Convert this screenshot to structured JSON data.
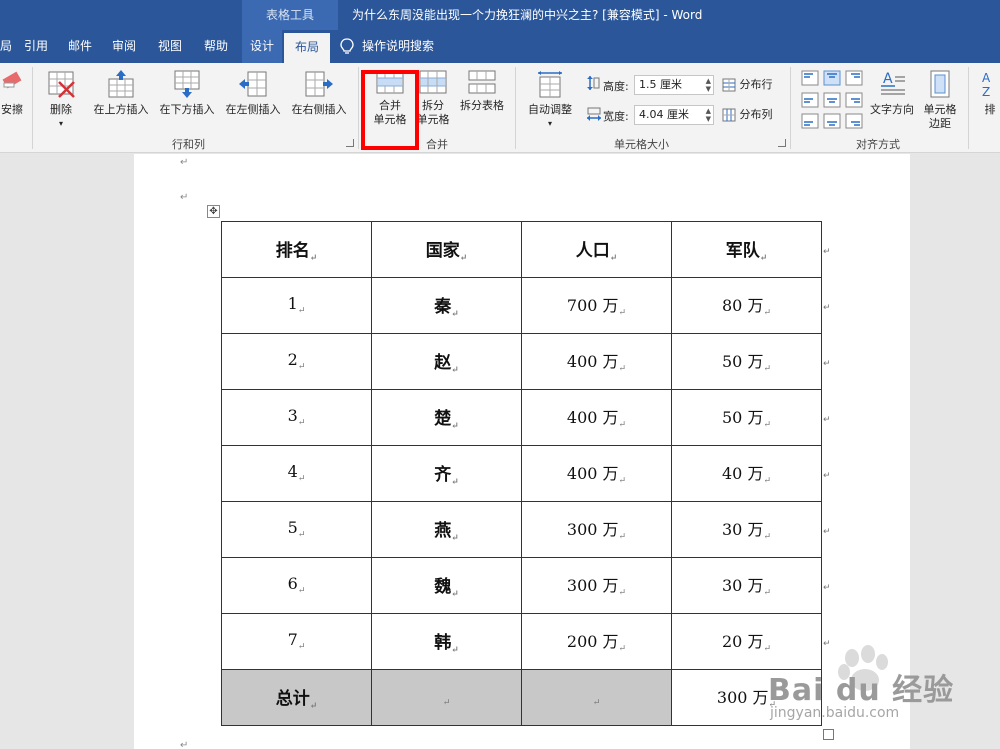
{
  "titlebar": {
    "context_tool": "表格工具",
    "doc_title": "为什么东周没能出现一个力挽狂澜的中兴之主? [兼容模式] - Word"
  },
  "tabs": {
    "partial_left": "局",
    "references": "引用",
    "mailings": "邮件",
    "review": "审阅",
    "view": "视图",
    "help": "帮助",
    "design": "设计",
    "layout": "布局",
    "tell_me": "操作说明搜索"
  },
  "ribbon": {
    "eraser_label": "擦",
    "eraser_label_full": "安擦",
    "delete_label": "删除",
    "insert_above": "在上方插入",
    "insert_below": "在下方插入",
    "insert_left": "在左侧插入",
    "insert_right": "在右侧插入",
    "rows_cols_group": "行和列",
    "merge_cells_line1": "合并",
    "merge_cells_line2": "单元格",
    "split_cells_line1": "拆分",
    "split_cells_line2": "单元格",
    "split_table": "拆分表格",
    "merge_group": "合并",
    "autofit": "自动调整",
    "height_label": "高度:",
    "height_value": "1.5 厘米",
    "width_label": "宽度:",
    "width_value": "4.04 厘米",
    "distribute_rows": "分布行",
    "distribute_cols": "分布列",
    "cell_size_group": "单元格大小",
    "text_direction": "文字方向",
    "cell_margins_line1": "单元格",
    "cell_margins_line2": "边距",
    "alignment_group": "对齐方式",
    "sort_partial": "排"
  },
  "table": {
    "headers": [
      "排名",
      "国家",
      "人口",
      "军队"
    ],
    "rows": [
      [
        "1",
        "秦",
        "700 万",
        "80 万"
      ],
      [
        "2",
        "赵",
        "400 万",
        "50 万"
      ],
      [
        "3",
        "楚",
        "400 万",
        "50 万"
      ],
      [
        "4",
        "齐",
        "400 万",
        "40 万"
      ],
      [
        "5",
        "燕",
        "300 万",
        "30 万"
      ],
      [
        "6",
        "魏",
        "300 万",
        "30 万"
      ],
      [
        "7",
        "韩",
        "200 万",
        "20 万"
      ]
    ],
    "total_label": "总计",
    "total_value": "300 万"
  },
  "watermark": {
    "brand": "Bai du 经验",
    "url": "jingyan.baidu.com"
  },
  "colors": {
    "word_blue": "#2b579a",
    "highlight_red": "#ff0000",
    "shade_gray": "#c8c8c8"
  }
}
